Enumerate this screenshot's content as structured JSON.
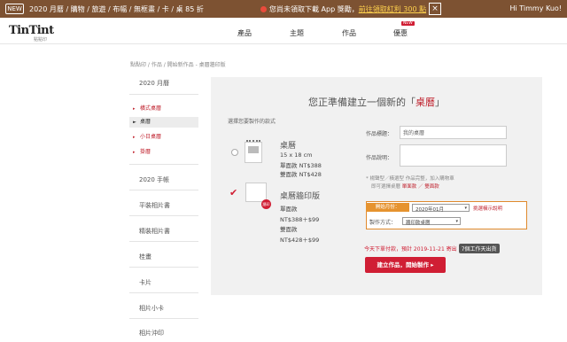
{
  "topbar": {
    "new_badge": "NEW",
    "promo": "2020 月曆 / 購物 / 旅遊 / 布幅 / 無框畫 / 卡 / 桌 85 折",
    "app_promo": "您尚未領取下載 App 獎勵，",
    "app_link": "前往領取紅利 300 點",
    "close": "×",
    "user": "Hi Timmy Kuo!"
  },
  "header": {
    "logo": "TinTint",
    "logo_sub": "點點印",
    "nav": [
      "產品",
      "主題",
      "作品",
      "優惠"
    ],
    "new_tag": "NEW"
  },
  "breadcrumb": "點點印 / 作品 / 開始新作品 - 桌曆牆印版",
  "sidebar": {
    "title": "2020 月曆",
    "items": [
      {
        "label": "橫式桌曆",
        "arrow": "▸"
      },
      {
        "label": "桌曆",
        "arrow": "►"
      },
      {
        "label": "小日桌曆",
        "arrow": "▸"
      },
      {
        "label": "掛曆",
        "arrow": "▸"
      }
    ],
    "categories": [
      "2020 手帳",
      "平裝相片書",
      "精裝相片書",
      "桂畫",
      "卡片",
      "相片小卡",
      "相片沖印"
    ]
  },
  "panel": {
    "title_prefix": "您正準備建立一個新的「",
    "title_keyword": "桌曆",
    "title_suffix": "」",
    "choose_label": "選擇您要製作的款式",
    "products": [
      {
        "name": "桌曆",
        "lines": [
          "15 x 18 cm",
          "單面款 NT$388",
          "雙面款 NT$428"
        ]
      },
      {
        "name": "桌曆牆印版",
        "stamp": "牆印",
        "lines": [
          "單面款",
          "NT$388＋$99",
          "雙面款",
          "NT$428＋$99"
        ]
      }
    ],
    "form": {
      "title_label": "作品標題：",
      "title_value": "我的桌曆",
      "desc_label": "作品說明：",
      "note1": "* 楊聲型／橫選型 作品完整，加入購物車",
      "note2_prefix": "即可選擇桌曆 ",
      "note2_link": "單面款 ／ 雙面款",
      "start_label": "開始月份：",
      "start_value": "2020年01月",
      "start_hint": "挑選橫示說明",
      "method_label": "製作方式：",
      "method_value": "牆印款桌曆"
    },
    "ship_text": "今天下單付款，預計 2019-11-21 寄出",
    "ship_days": "7個工作天出貨",
    "cta": "建立作品，開始製作 ▸"
  }
}
